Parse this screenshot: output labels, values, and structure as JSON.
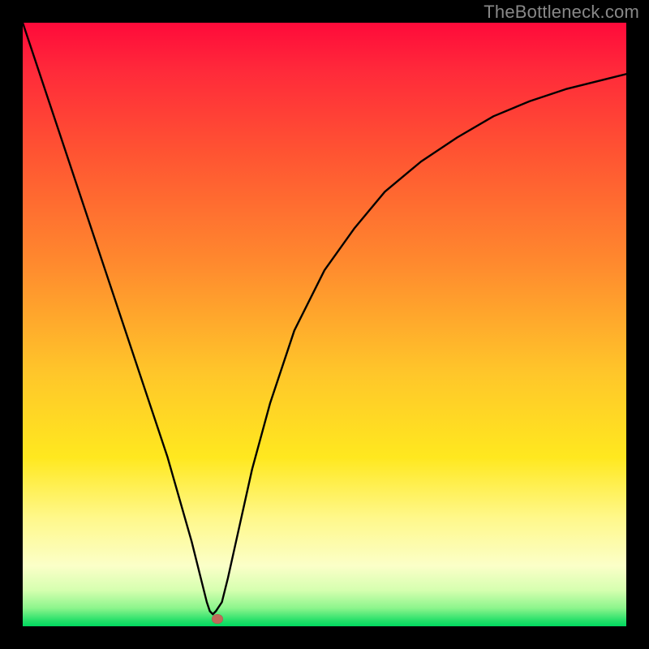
{
  "watermark": "TheBottleneck.com",
  "colors": {
    "page_bg": "#000000",
    "curve_stroke": "#000000",
    "marker_fill": "#c06a5a",
    "watermark_text": "#888888"
  },
  "chart_data": {
    "type": "line",
    "title": "",
    "xlabel": "",
    "ylabel": "",
    "xlim": [
      0,
      100
    ],
    "ylim": [
      0,
      100
    ],
    "x": [
      0,
      3,
      6,
      9,
      12,
      15,
      18,
      21,
      24,
      26,
      28,
      29.5,
      30.5,
      31,
      31.5,
      32,
      33,
      34,
      36,
      38,
      41,
      45,
      50,
      55,
      60,
      66,
      72,
      78,
      84,
      90,
      96,
      100
    ],
    "values": [
      100,
      91,
      82,
      73,
      64,
      55,
      46,
      37,
      28,
      21,
      14,
      8,
      4,
      2.5,
      2,
      2.5,
      4,
      8,
      17,
      26,
      37,
      49,
      59,
      66,
      72,
      77,
      81,
      84.5,
      87,
      89,
      90.5,
      91.5
    ],
    "marker": {
      "x": 32.3,
      "y": 1.2
    },
    "gradient_stops": [
      {
        "pos": 0,
        "color": "#ff0a3a"
      },
      {
        "pos": 8,
        "color": "#ff2a3a"
      },
      {
        "pos": 22,
        "color": "#ff5532"
      },
      {
        "pos": 40,
        "color": "#ff8a2e"
      },
      {
        "pos": 58,
        "color": "#ffc62a"
      },
      {
        "pos": 72,
        "color": "#ffe81f"
      },
      {
        "pos": 82,
        "color": "#fff88a"
      },
      {
        "pos": 90,
        "color": "#fbffc8"
      },
      {
        "pos": 94,
        "color": "#d6ffb0"
      },
      {
        "pos": 97,
        "color": "#8cf58c"
      },
      {
        "pos": 99,
        "color": "#27e06a"
      },
      {
        "pos": 100,
        "color": "#00d85f"
      }
    ]
  }
}
